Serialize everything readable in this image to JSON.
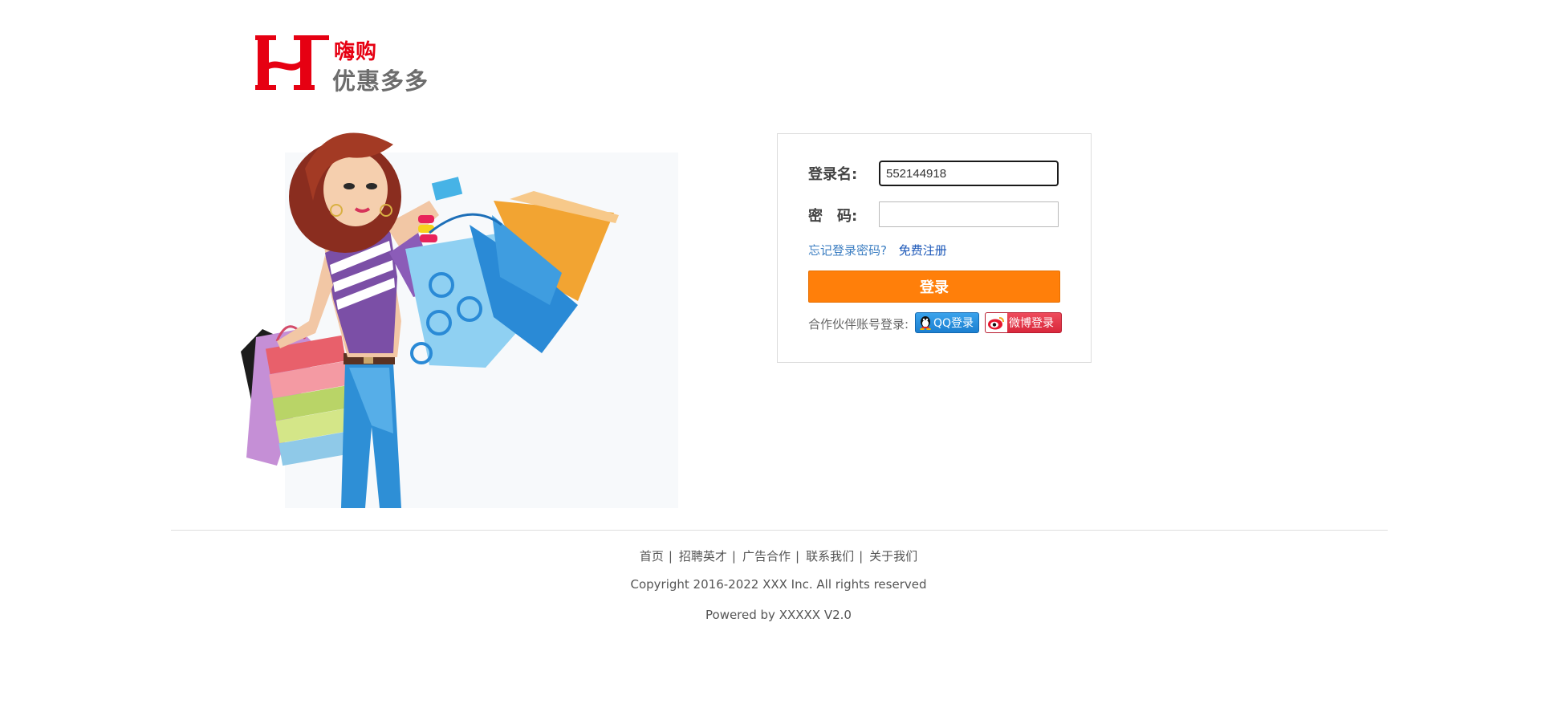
{
  "header": {
    "brand": "嗨购",
    "slogan": "优惠多多"
  },
  "login": {
    "username_label": "登录名:",
    "username_value": "552144918",
    "password_label": "密　码:",
    "password_value": "",
    "forgot_link": "忘记登录密码?",
    "register_link": "免费注册",
    "submit_label": "登录",
    "partner_label": "合作伙伴账号登录:",
    "qq_login": "QQ登录",
    "weibo_login": "微博登录"
  },
  "footer": {
    "links": [
      "首页",
      "招聘英才",
      "广告合作",
      "联系我们",
      "关于我们"
    ],
    "separator": "|",
    "copyright": "Copyright 2016-2022 XXX Inc. All rights reserved",
    "powered": "Powered by XXXXX V2.0"
  },
  "colors": {
    "brand_red": "#e60012",
    "login_button": "#ff7f0a",
    "qq_blue": "#1b7fd0",
    "weibo_red": "#d9283c",
    "link_blue": "#3c7ec2"
  }
}
